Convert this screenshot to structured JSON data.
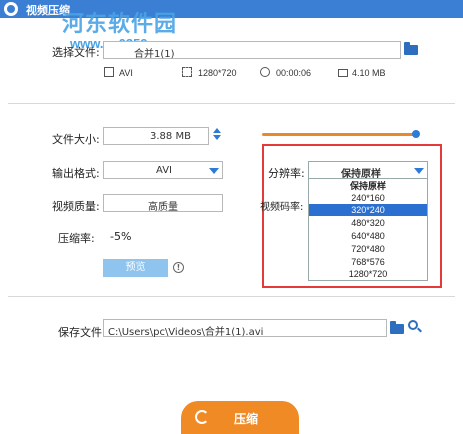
{
  "window": {
    "title": "视频压缩"
  },
  "watermark": {
    "name": "河东软件园",
    "url": "www.pc0359.cn"
  },
  "source": {
    "label": "选择文件:",
    "value": "合并1(1)",
    "meta": {
      "format": "AVI",
      "resolution": "1280*720",
      "duration": "00:00:06",
      "size": "4.10 MB"
    }
  },
  "settings": {
    "file_size": {
      "label": "文件大小:",
      "value": "3.88 MB",
      "slider_fraction": 1.0
    },
    "output_format": {
      "label": "输出格式:",
      "value": "AVI"
    },
    "video_quality": {
      "label": "视频质量:",
      "value": "高质量"
    },
    "compression_rate": {
      "label": "压缩率:",
      "value": "-5%"
    },
    "resolution": {
      "label": "分辨率:",
      "value": "保持原样",
      "options": [
        "保持原样",
        "240*160",
        "320*240",
        "480*320",
        "640*480",
        "720*480",
        "768*576",
        "1280*720"
      ],
      "highlighted": "320*240"
    },
    "bitrate": {
      "label": "视频码率:"
    }
  },
  "preview_button": {
    "label": "预览"
  },
  "save": {
    "label": "保存文件:",
    "path": "C:\\Users\\pc\\Videos\\合并1(1).avi"
  },
  "compress_button": {
    "label": "压缩"
  },
  "colors": {
    "accent": "#2d7bd6",
    "orange": "#f08a25",
    "highlight_box": "#e43a3a"
  }
}
